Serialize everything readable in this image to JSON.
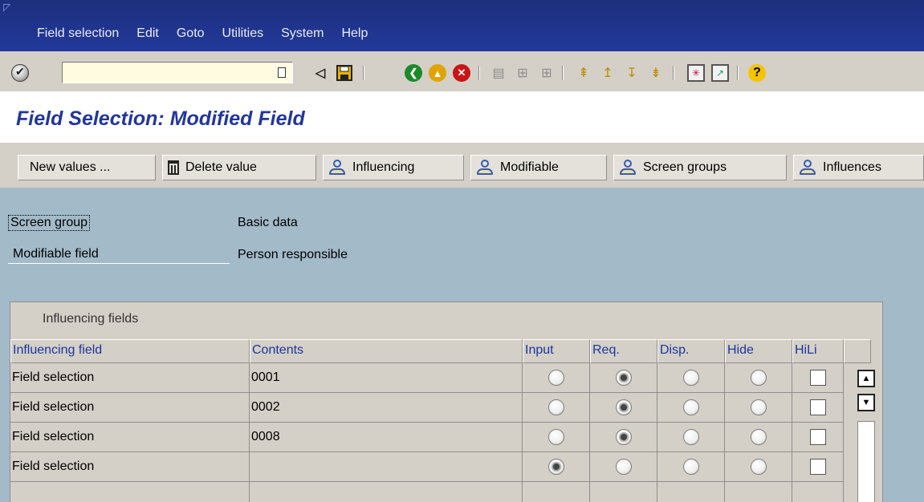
{
  "menu": {
    "items": [
      "Field selection",
      "Edit",
      "Goto",
      "Utilities",
      "System",
      "Help"
    ]
  },
  "toolbar": {
    "command_value": "",
    "icons": [
      "check-icon",
      "command-doc-icon",
      "back-nav-icon",
      "save-icon",
      "back-icon",
      "exit-icon",
      "cancel-icon",
      "print-icon",
      "find-icon",
      "find-next-icon",
      "first-page-icon",
      "previous-page-icon",
      "next-page-icon",
      "last-page-icon",
      "create-session-icon",
      "shortcut-icon",
      "help-icon"
    ]
  },
  "page": {
    "title": "Field Selection: Modified Field"
  },
  "app_toolbar": {
    "new_values": "New values ...",
    "delete_value": "Delete value",
    "influencing": "Influencing",
    "modifiable": "Modifiable",
    "screen_groups": "Screen groups",
    "influences": "Influences"
  },
  "form": {
    "screen_group_label": "Screen group",
    "screen_group_value": "Basic data",
    "modifiable_field_label": "Modifiable field",
    "modifiable_field_value": "Person responsible"
  },
  "table": {
    "title": "Influencing fields",
    "columns": [
      "Influencing field",
      "Contents",
      "Input",
      "Req.",
      "Disp.",
      "Hide",
      "HiLi"
    ],
    "rows": [
      {
        "field": "Field selection",
        "contents": "0001",
        "selected": "Req.",
        "hili": false
      },
      {
        "field": "Field selection",
        "contents": "0002",
        "selected": "Req.",
        "hili": false
      },
      {
        "field": "Field selection",
        "contents": "0008",
        "selected": "Req.",
        "hili": false
      },
      {
        "field": "Field selection",
        "contents": "",
        "selected": "Input",
        "hili": false
      }
    ]
  },
  "colors": {
    "menubar": "#1d2f7e",
    "title": "#23369a",
    "content_bg": "#a3bac9",
    "panel": "#d4d0c8",
    "header_text": "#1a36a0"
  }
}
